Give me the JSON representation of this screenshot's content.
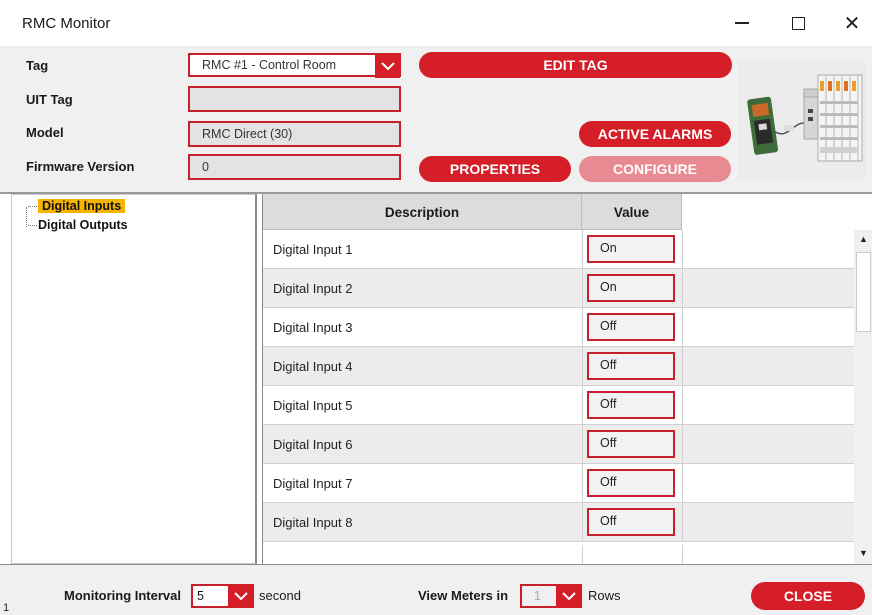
{
  "window": {
    "title": "RMC Monitor",
    "minimize_icon": "minimize-icon",
    "maximize_icon": "maximize-icon",
    "close_icon": "close-icon",
    "close_glyph": "✕"
  },
  "form": {
    "tag": {
      "label": "Tag",
      "value": "RMC #1 - Control Room"
    },
    "uit_tag": {
      "label": "UIT Tag",
      "value": ""
    },
    "model": {
      "label": "Model",
      "value": "RMC Direct (30)"
    },
    "firmware": {
      "label": "Firmware Version",
      "value": "0"
    }
  },
  "buttons": {
    "edit_tag": "EDIT TAG",
    "active_alarms": "ACTIVE ALARMS",
    "properties": "PROPERTIES",
    "configure": "CONFIGURE",
    "close": "CLOSE"
  },
  "tree": {
    "items": [
      {
        "label": "Digital Inputs",
        "selected": true
      },
      {
        "label": "Digital Outputs",
        "selected": false
      }
    ]
  },
  "grid": {
    "columns": [
      "Description",
      "Value"
    ],
    "rows": [
      {
        "description": "Digital Input 1",
        "value": "On"
      },
      {
        "description": "Digital Input 2",
        "value": "On"
      },
      {
        "description": "Digital Input 3",
        "value": "Off"
      },
      {
        "description": "Digital Input 4",
        "value": "Off"
      },
      {
        "description": "Digital Input 5",
        "value": "Off"
      },
      {
        "description": "Digital Input 6",
        "value": "Off"
      },
      {
        "description": "Digital Input 7",
        "value": "Off"
      },
      {
        "description": "Digital Input 8",
        "value": "Off"
      }
    ]
  },
  "bottom": {
    "monitoring_label": "Monitoring Interval",
    "monitoring_value": "5",
    "monitoring_unit": "second",
    "meters_label": "View Meters in",
    "meters_value": "1",
    "meters_unit": "Rows",
    "corner_number": "1"
  },
  "colors": {
    "accent": "#d51e28",
    "accent_disabled": "#e88a91",
    "selection": "#f5b400"
  }
}
